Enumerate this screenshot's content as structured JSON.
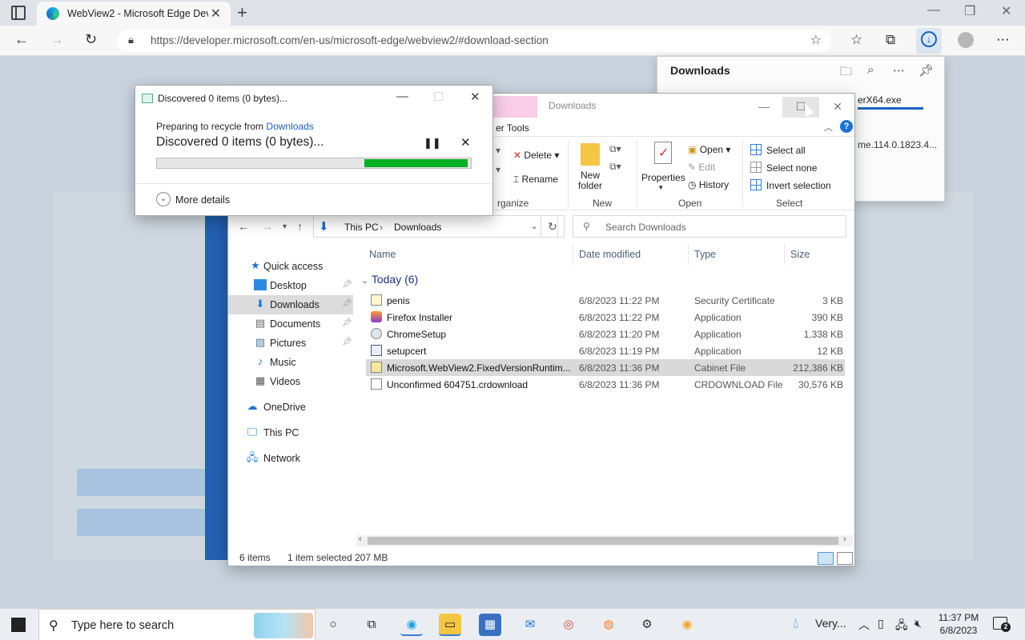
{
  "browser": {
    "tab_title": "WebView2 - Microsoft Edge Dev",
    "tab_close": "✕",
    "new_tab": "+",
    "url": "https://developer.microsoft.com/en-us/microsoft-edge/webview2/#download-section",
    "window_min": "—",
    "window_max": "❐",
    "window_close": "✕"
  },
  "downloads_panel": {
    "title": "Downloads",
    "item1_name": "erX64.exe",
    "item2_name": "me.114.0.1823.4..."
  },
  "explorer": {
    "title": "Downloads",
    "ribbon_tab": "er Tools",
    "ribbon": {
      "delete": "Delete",
      "rename": "Rename",
      "organize_label": "rganize",
      "new_folder": "New folder",
      "new_label": "New",
      "properties": "Properties",
      "open": "Open",
      "edit": "Edit",
      "history": "History",
      "open_label": "Open",
      "select_all": "Select all",
      "select_none": "Select none",
      "invert_selection": "Invert selection",
      "select_label": "Select"
    },
    "breadcrumb": {
      "this_pc": "This PC",
      "sep": "›",
      "downloads": "Downloads"
    },
    "search_placeholder": "Search Downloads",
    "nav": {
      "quick_access": "Quick access",
      "desktop": "Desktop",
      "downloads": "Downloads",
      "documents": "Documents",
      "pictures": "Pictures",
      "music": "Music",
      "videos": "Videos",
      "onedrive": "OneDrive",
      "this_pc": "This PC",
      "network": "Network"
    },
    "columns": {
      "name": "Name",
      "date": "Date modified",
      "type": "Type",
      "size": "Size"
    },
    "group": "Today (6)",
    "files": [
      {
        "name": "penis",
        "date": "6/8/2023 11:22 PM",
        "type": "Security Certificate",
        "size": "3 KB"
      },
      {
        "name": "Firefox Installer",
        "date": "6/8/2023 11:22 PM",
        "type": "Application",
        "size": "390 KB"
      },
      {
        "name": "ChromeSetup",
        "date": "6/8/2023 11:20 PM",
        "type": "Application",
        "size": "1,338 KB"
      },
      {
        "name": "setupcert",
        "date": "6/8/2023 11:19 PM",
        "type": "Application",
        "size": "12 KB"
      },
      {
        "name": "Microsoft.WebView2.FixedVersionRuntim...",
        "date": "6/8/2023 11:36 PM",
        "type": "Cabinet File",
        "size": "212,386 KB"
      },
      {
        "name": "Unconfirmed 604751.crdownload",
        "date": "6/8/2023 11:36 PM",
        "type": "CRDOWNLOAD File",
        "size": "30,576 KB"
      }
    ],
    "status": {
      "count": "6 items",
      "selected": "1 item selected",
      "size": "207 MB"
    }
  },
  "dialog": {
    "title": "Discovered 0 items (0 bytes)...",
    "prep_prefix": "Preparing to recycle from",
    "prep_link": "Downloads",
    "status": "Discovered 0 items (0 bytes)...",
    "progress": 0.33,
    "more_details": "More details"
  },
  "taskbar": {
    "search_placeholder": "Type here to search",
    "weather": "Very...",
    "time": "11:37 PM",
    "date": "6/8/2023",
    "notif_count": "2"
  },
  "colors": {
    "accent": "#1e73d2",
    "progress": "#06b025",
    "selection": "#d9d9d9"
  }
}
